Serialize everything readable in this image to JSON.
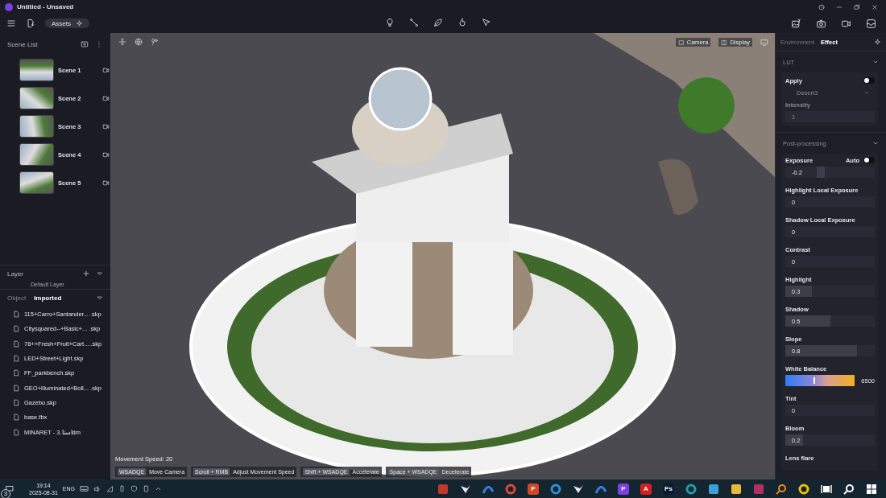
{
  "window": {
    "title": "Untitled - Unsaved"
  },
  "toolbar": {
    "assets_label": "Assets"
  },
  "scene_list": {
    "title": "Scene List",
    "scenes": [
      {
        "name": "Scene 1",
        "selected": false
      },
      {
        "name": "Scene 2",
        "selected": false
      },
      {
        "name": "Scene 3",
        "selected": false
      },
      {
        "name": "Scene 4",
        "selected": false
      },
      {
        "name": "Scene 5",
        "selected": false
      }
    ]
  },
  "layer": {
    "title": "Layer",
    "items": [
      "Default Layer"
    ]
  },
  "object_tabs": [
    {
      "label": "Object",
      "selected": false
    },
    {
      "label": "Imported",
      "selected": true
    }
  ],
  "files": [
    "115+Carro+Santander... .skp",
    "Citysquared--+Basic+... .skp",
    "78++Fresh+Fruit+Cart.....skp",
    "LED+Street+Light.skp",
    "FF_parkbench.skp",
    "GEO+illuminated+Boll... .skp",
    "Gazebo.skp",
    "base.fbx",
    "MINARET - استا.3dm"
  ],
  "viewport": {
    "camera_label": "Camera",
    "display_label": "Display",
    "movement_speed": "Movement Speed: 20",
    "hints": [
      {
        "key": "WSADQE",
        "action": "Move Camera"
      },
      {
        "key": "Scroll + RMB",
        "action": "Adjust Movement Speed"
      },
      {
        "key": "Shift + WSADQE",
        "action": "Accelerate"
      },
      {
        "key": "Space + WSADQE",
        "action": "Decelerate"
      }
    ]
  },
  "right_tabs": [
    {
      "label": "Environment",
      "selected": false
    },
    {
      "label": "Effect",
      "selected": true
    }
  ],
  "lut": {
    "title": "LUT",
    "apply_label": "Apply",
    "apply_on": false,
    "preset": "Desert3",
    "intensity_label": "Intensity",
    "intensity": "1",
    "disabled": true
  },
  "post": {
    "title": "Post-processing",
    "items": [
      {
        "kind": "slider",
        "label": "Exposure",
        "value": "-0.2",
        "level": 0.4,
        "toggle_label": "Auto",
        "toggle_on": false
      },
      {
        "kind": "slider",
        "label": "Highlight Local Exposure",
        "value": "0"
      },
      {
        "kind": "slider",
        "label": "Shadow Local Exposure",
        "value": "0"
      },
      {
        "kind": "slider",
        "label": "Contrast",
        "value": "0"
      },
      {
        "kind": "slider",
        "label": "Highlight",
        "value": "0.3",
        "level": 0.3
      },
      {
        "kind": "slider",
        "label": "Shadow",
        "value": "0.5",
        "level": 0.5
      },
      {
        "kind": "slider",
        "label": "Slope",
        "value": "0.8",
        "level": 0.8
      },
      {
        "kind": "gradient",
        "label": "White Balance",
        "value": "6500",
        "level": 0.4
      },
      {
        "kind": "slider",
        "label": "Tint",
        "value": "0"
      },
      {
        "kind": "slider",
        "label": "Bloom",
        "value": "0.2",
        "level": 0.2
      },
      {
        "kind": "label",
        "label": "Lens flare"
      }
    ]
  },
  "taskbar": {
    "badge": "3",
    "time": "19:14",
    "date": "2025-08-31",
    "language": "ENG",
    "apps": [
      {
        "kind": "tile",
        "color": "#c0392b"
      },
      {
        "kind": "wing",
        "color": "#e8e8e8"
      },
      {
        "kind": "arc",
        "color": "#3b7de0"
      },
      {
        "kind": "ring",
        "color": "#e04a3a"
      },
      {
        "kind": "letter",
        "color": "#d24726",
        "glyph": "P"
      },
      {
        "kind": "ring",
        "color": "#2f8fd8"
      },
      {
        "kind": "wing",
        "color": "#e8e8e8"
      },
      {
        "kind": "arc",
        "color": "#3b7de0"
      },
      {
        "kind": "letter",
        "color": "#7b3fe4",
        "glyph": "P"
      },
      {
        "kind": "letter",
        "color": "#d42020",
        "glyph": "A"
      },
      {
        "kind": "letter",
        "color": "#0b1a33",
        "glyph": "Ps"
      },
      {
        "kind": "ring",
        "color": "#1fa0a8"
      },
      {
        "kind": "tile",
        "color": "#3aa0d8"
      },
      {
        "kind": "tile",
        "color": "#e8b838"
      },
      {
        "kind": "tile",
        "color": "#b03060"
      },
      {
        "kind": "search",
        "color": "#f08a1c"
      },
      {
        "kind": "ring",
        "color": "#f2c200"
      },
      {
        "kind": "taskview",
        "color": "#ffffff"
      },
      {
        "kind": "search",
        "color": "#ffffff"
      },
      {
        "kind": "windows",
        "color": "#ffffff"
      }
    ]
  }
}
